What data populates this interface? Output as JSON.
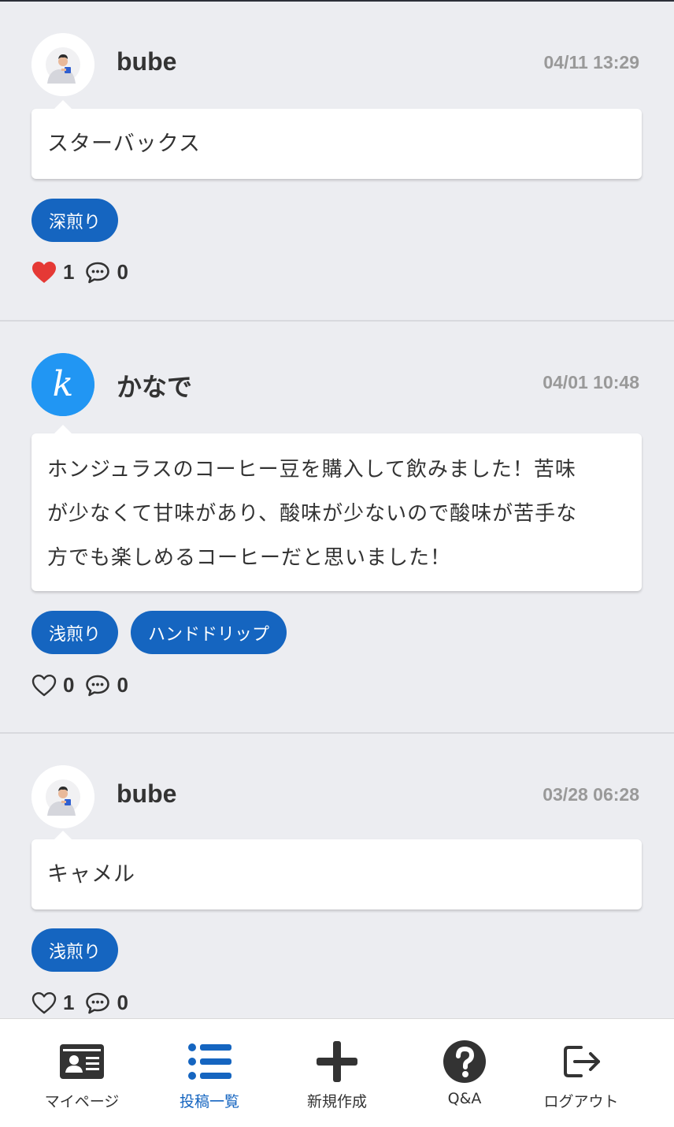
{
  "posts": [
    {
      "username": "bube",
      "avatar": "person-avatar",
      "timestamp": "04/11 13:29",
      "body": "スターバックス",
      "tags": [
        "深煎り"
      ],
      "liked": true,
      "likes": "1",
      "comments": "0"
    },
    {
      "username": "かなで",
      "avatar": "letter-k-avatar",
      "avatar_letter": "k",
      "timestamp": "04/01 10:48",
      "body_lines": [
        "ホンジュラスのコーヒー豆を購入して飲みました！苦味",
        "が少なくて甘味があり、酸味が少ないので酸味が苦手な",
        "方でも楽しめるコーヒーだと思いました！"
      ],
      "tags": [
        "浅煎り",
        "ハンドドリップ"
      ],
      "liked": false,
      "likes": "0",
      "comments": "0"
    },
    {
      "username": "bube",
      "avatar": "person-avatar",
      "timestamp": "03/28 06:28",
      "body": "キャメル",
      "tags": [
        "浅煎り"
      ],
      "liked": false,
      "likes": "1",
      "comments": "0"
    }
  ],
  "nav": {
    "mypage": "マイページ",
    "posts": "投稿一覧",
    "new_post": "新規作成",
    "qa": "Q&A",
    "logout": "ログアウト",
    "active": "posts"
  },
  "colors": {
    "accent": "#1565c0",
    "like_red": "#e53935",
    "avatar_blue": "#2196f3",
    "page_bg": "#ecedf1"
  }
}
